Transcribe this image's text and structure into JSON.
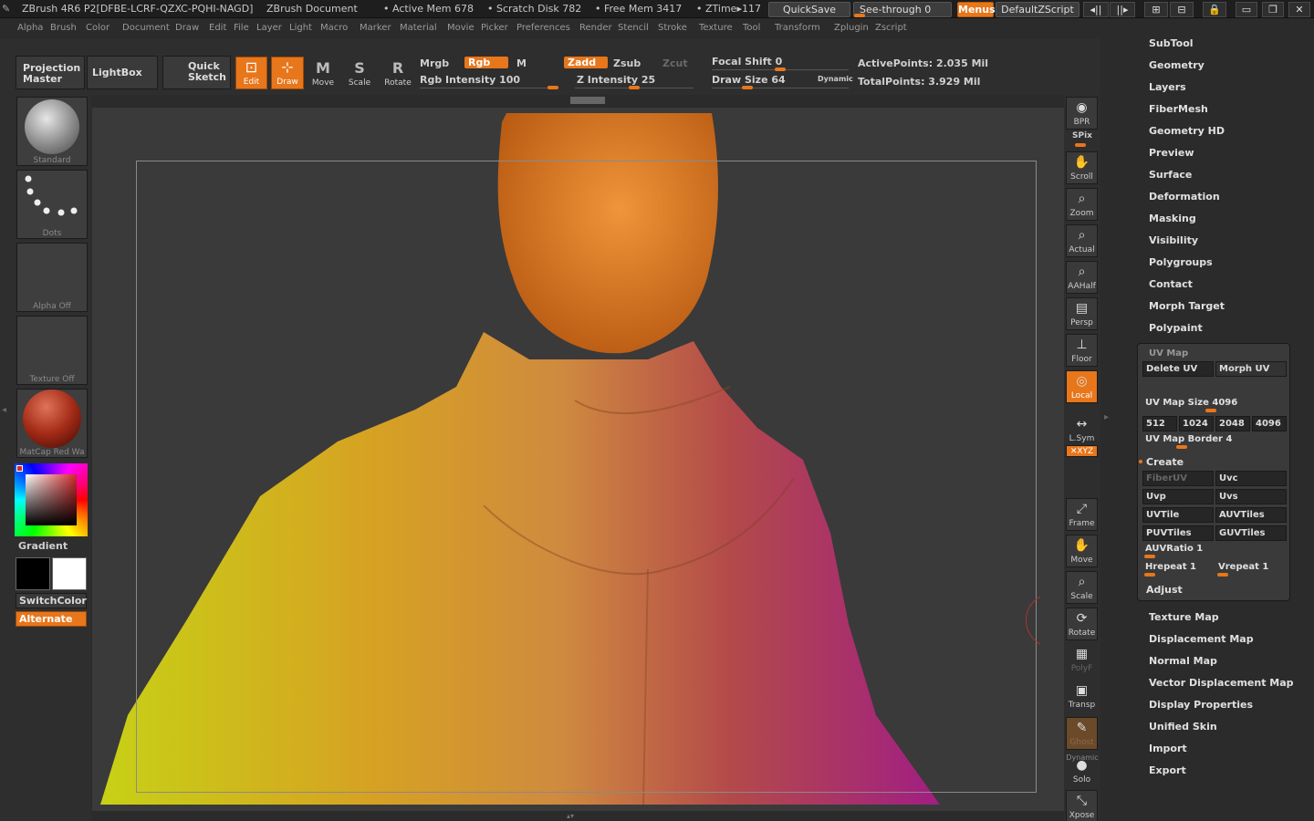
{
  "titlebar": {
    "app": "ZBrush 4R6 P2[DFBE-LCRF-QZXC-PQHI-NAGD]",
    "document": "ZBrush Document",
    "active_mem": "• Active Mem 678",
    "scratch_disk": "• Scratch Disk 782",
    "free_mem": "• Free Mem 3417",
    "ztime": "• ZTime▸117",
    "quicksave": "QuickSave",
    "seethrough": "See-through   0",
    "menus": "Menus",
    "script": "DefaultZScript"
  },
  "menubar": [
    "Alpha",
    "Brush",
    "Color",
    "Document",
    "Draw",
    "Edit",
    "File",
    "Layer",
    "Light",
    "Macro",
    "Marker",
    "Material",
    "Movie",
    "Picker",
    "Preferences",
    "Render",
    "Stencil",
    "Stroke",
    "Texture",
    "Tool",
    "Transform",
    "Zplugin",
    "Zscript"
  ],
  "toolbar": {
    "projection_master": "Projection Master",
    "lightbox": "LightBox",
    "quick_sketch": "Quick Sketch",
    "edit": "Edit",
    "draw": "Draw",
    "move": "Move",
    "scale": "Scale",
    "rotate": "Rotate",
    "mrgb": "Mrgb",
    "rgb": "Rgb",
    "m": "M",
    "rgb_intensity": "Rgb Intensity 100",
    "zadd": "Zadd",
    "zsub": "Zsub",
    "zcut": "Zcut",
    "z_intensity": "Z Intensity 25",
    "focal_shift": "Focal Shift 0",
    "draw_size": "Draw Size 64",
    "dynamic": "Dynamic",
    "active_points": "ActivePoints: 2.035  Mil",
    "total_points": "TotalPoints: 3.929  Mil"
  },
  "leftshelf": {
    "brush": "Standard",
    "stroke": "Dots",
    "alpha": "Alpha  Off",
    "texture": "Texture  Off",
    "material": "MatCap  Red  Wa",
    "gradient": "Gradient",
    "switchcolor": "SwitchColor",
    "alternate": "Alternate"
  },
  "rightshelf": {
    "bpr": "BPR",
    "spix": "SPix",
    "scroll": "Scroll",
    "zoom": "Zoom",
    "actual": "Actual",
    "aahalf": "AAHalf",
    "persp": "Persp",
    "floor": "Floor",
    "local": "Local",
    "lsym": "L.Sym",
    "xyz": "✕XYZ",
    "frame": "Frame",
    "move": "Move",
    "scale": "Scale",
    "rotate": "Rotate",
    "polyf": "PolyF",
    "transp": "Transp",
    "ghost": "Ghost",
    "dynamic": "Dynamic",
    "solo": "Solo",
    "xpose": "Xpose"
  },
  "palette": {
    "items_top": [
      "SubTool",
      "Geometry",
      "Layers",
      "FiberMesh",
      "Geometry HD",
      "Preview",
      "Surface",
      "Deformation",
      "Masking",
      "Visibility",
      "Polygroups",
      "Contact",
      "Morph Target",
      "Polypaint"
    ],
    "uvmap": {
      "title": "UV Map",
      "delete_uv": "Delete UV",
      "morph_uv": "Morph UV",
      "size_label": "UV Map Size 4096",
      "sizes": [
        "512",
        "1024",
        "2048",
        "4096"
      ],
      "border_label": "UV Map Border 4",
      "create": "Create",
      "fiberuv": "FiberUV",
      "uvc": "Uvc",
      "uvp": "Uvp",
      "uvs": "Uvs",
      "uvtile": "UVTile",
      "auvtiles": "AUVTiles",
      "puvtiles": "PUVTiles",
      "guvtiles": "GUVTiles",
      "auvratio": "AUVRatio 1",
      "hrepeat": "Hrepeat 1",
      "vrepeat": "Vrepeat 1",
      "adjust": "Adjust"
    },
    "items_bottom": [
      "Texture Map",
      "Displacement Map",
      "Normal Map",
      "Vector Displacement Map",
      "Display Properties",
      "Unified Skin",
      "Import",
      "Export"
    ]
  },
  "colors": {
    "accent": "#e8761b",
    "panel": "#3a3a3a"
  }
}
